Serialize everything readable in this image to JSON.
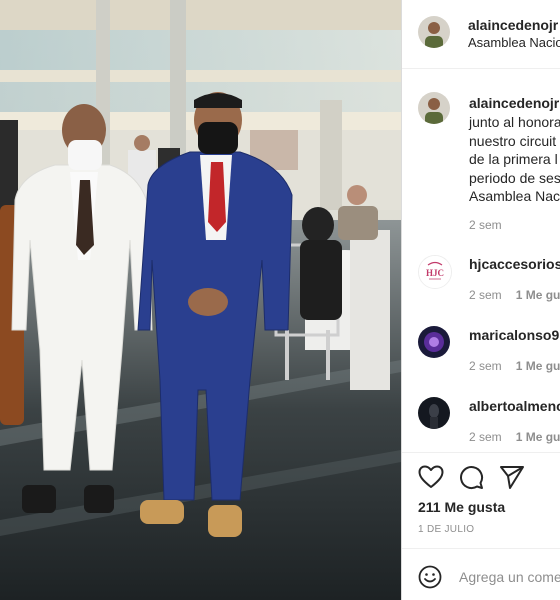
{
  "post": {
    "author": "alaincedenojr",
    "location": "Asamblea Nacional",
    "caption_lines": [
      "junto al honora",
      "nuestro circuit",
      "de la primera l",
      "periodo de ses",
      "Asamblea Nac"
    ],
    "caption_age": "2 sem"
  },
  "comments": [
    {
      "user": "hjcaccesorios",
      "age": "2 sem",
      "likes": "1 Me gu",
      "avatar_text": "HJC"
    },
    {
      "user": "maricalonso9",
      "age": "2 sem",
      "likes": "1 Me gu"
    },
    {
      "user": "albertoalmeno",
      "age": "2 sem",
      "likes": "1 Me gu"
    }
  ],
  "engagement": {
    "likes_label": "211 Me gusta",
    "date_label": "1 DE JULIO"
  },
  "icons": [
    "heart-icon",
    "comment-icon",
    "share-icon",
    "emoji-icon"
  ],
  "add_comment": {
    "placeholder": "Agrega un comentario..."
  },
  "colors": {
    "text": "#262626",
    "muted": "#8e8e8e",
    "border": "#dbdbdb",
    "suit_blue": "#2a3f8f"
  }
}
